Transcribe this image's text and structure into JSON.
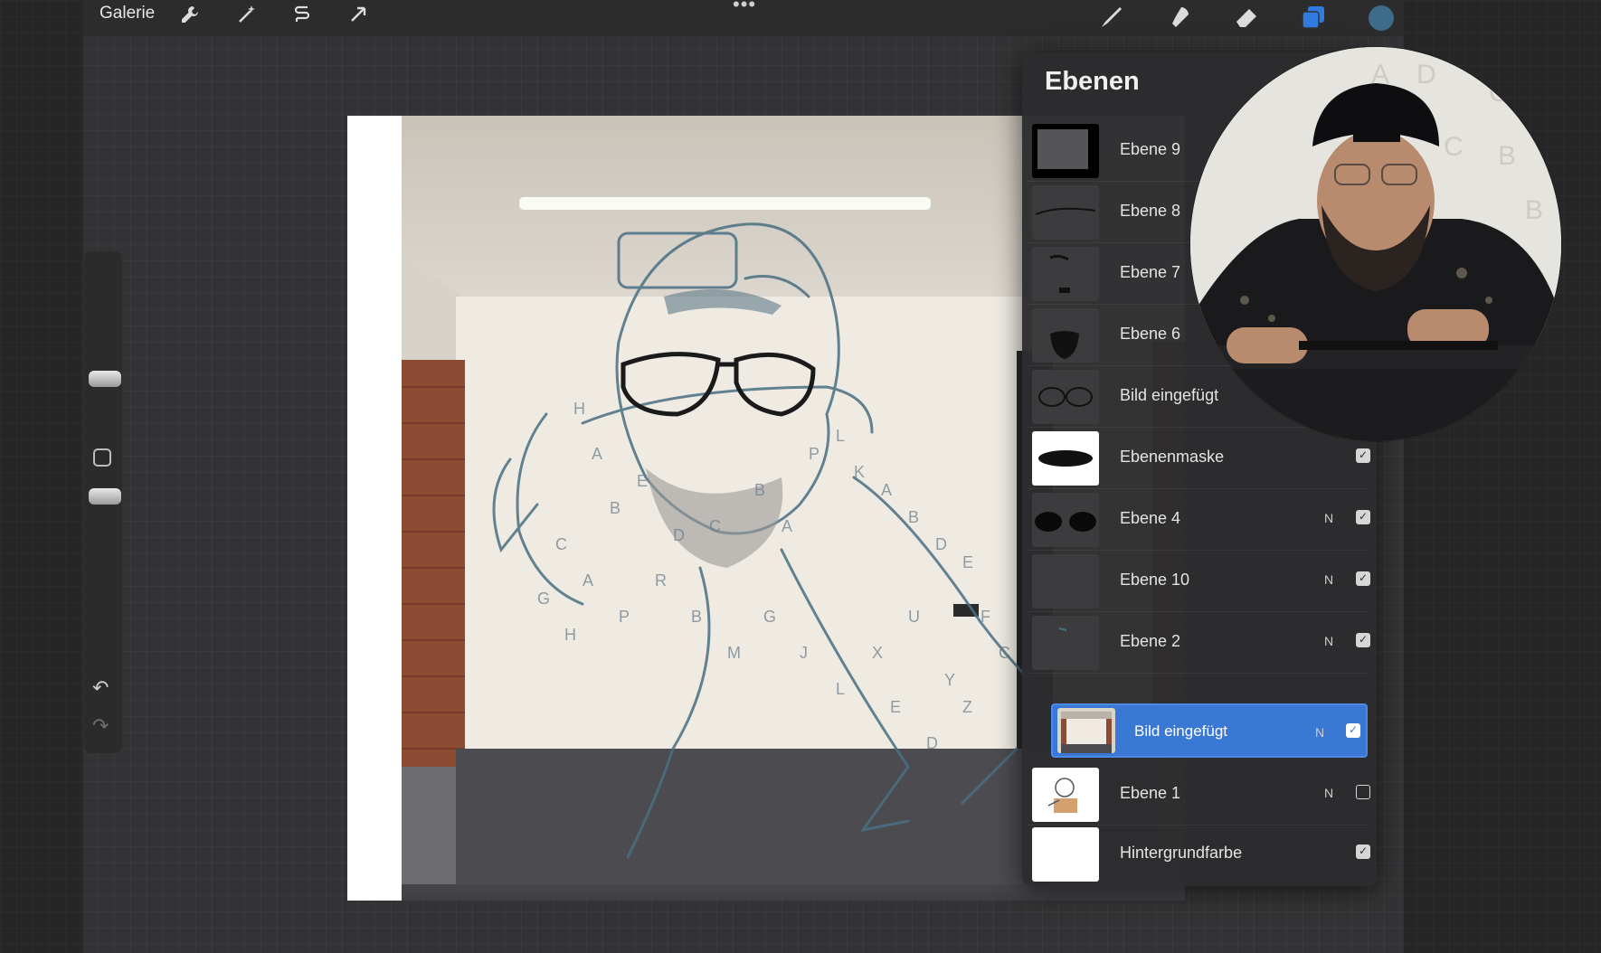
{
  "topbar": {
    "gallery_label": "Galerie",
    "left_tools": [
      "wrench-icon",
      "magic-wand-icon",
      "selection-icon",
      "transform-arrow-icon"
    ],
    "right_tools": [
      "brush-icon",
      "smudge-icon",
      "eraser-icon",
      "layers-icon",
      "color-icon"
    ],
    "active_color": "#3d6b8a",
    "layers_icon_color": "#2f7be0"
  },
  "sidebar": {
    "tools": [
      "brush-size-slider",
      "modify-button",
      "opacity-slider",
      "undo-icon",
      "redo-icon"
    ]
  },
  "layers_panel": {
    "title": "Ebenen",
    "layers": [
      {
        "name": "Ebene 9",
        "blend": "",
        "checked": null
      },
      {
        "name": "Ebene 8",
        "blend": "",
        "checked": null
      },
      {
        "name": "Ebene 7",
        "blend": "",
        "checked": null
      },
      {
        "name": "Ebene 6",
        "blend": "",
        "checked": null
      },
      {
        "name": "Bild eingefügt",
        "blend": "",
        "checked": null
      },
      {
        "name": "Ebenenmaske",
        "blend": "",
        "checked": true
      },
      {
        "name": "Ebene 4",
        "blend": "N",
        "checked": true
      },
      {
        "name": "Ebene 10",
        "blend": "N",
        "checked": true
      },
      {
        "name": "Ebene 2",
        "blend": "N",
        "checked": true
      },
      {
        "name": "Bild eingefügt",
        "blend": "N",
        "checked": true,
        "active": true
      },
      {
        "name": "Ebene 1",
        "blend": "N",
        "checked": false
      },
      {
        "name": "Hintergrundfarbe",
        "blend": "",
        "checked": true
      }
    ]
  },
  "colors": {
    "accent": "#3a78d6",
    "panel": "#2c2c2e",
    "sketch_line": "#4a6f82"
  }
}
